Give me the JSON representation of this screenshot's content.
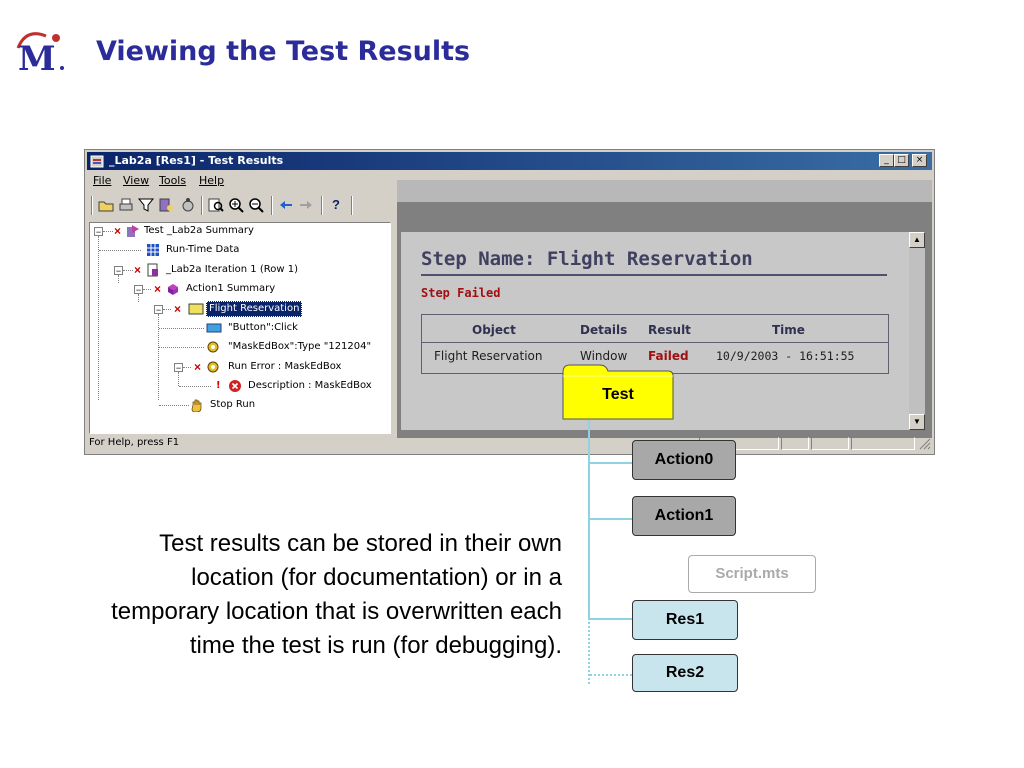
{
  "slide": {
    "title": "Viewing the Test Results",
    "logo_text": "M",
    "body_text": "Test results can be stored in their own location (for documentation) or in a temporary location that is overwritten each time the test is run (for debugging)."
  },
  "window": {
    "title": "_Lab2a [Res1] - Test Results",
    "controls": {
      "minimize": "_",
      "maximize": "□",
      "close": "×"
    },
    "menu": [
      "File",
      "View",
      "Tools",
      "Help"
    ],
    "status": "For Help, press F1"
  },
  "tree": {
    "root": "Test _Lab2a Summary",
    "runtime": "Run-Time Data",
    "iteration": "_Lab2a Iteration 1 (Row 1)",
    "action_summary": "Action1 Summary",
    "step": "Flight Reservation",
    "button_click": "\"Button\":Click",
    "maskedbox_type": "\"MaskEdBox\":Type \"121204\"",
    "run_error": "Run Error : MaskEdBox",
    "description": "Description : MaskEdBox",
    "stop_run": "Stop Run",
    "expander_minus": "−"
  },
  "step_details": {
    "title": "Step Name: Flight Reservation",
    "status": "Step Failed",
    "columns": [
      "Object",
      "Details",
      "Result",
      "Time"
    ],
    "row": [
      "Flight Reservation",
      "Window",
      "Failed",
      "10/9/2003 - 16:51:55"
    ]
  },
  "diagram": {
    "folder": "Test",
    "items": [
      "Action0",
      "Action1",
      "Script.mts",
      "Res1",
      "Res2"
    ],
    "colors": {
      "folder": "#ffff00",
      "action": "#a8a8a8",
      "res": "#c8e4ec",
      "connector": "#8fd3e3",
      "script_border": "#aaaaaa"
    }
  }
}
